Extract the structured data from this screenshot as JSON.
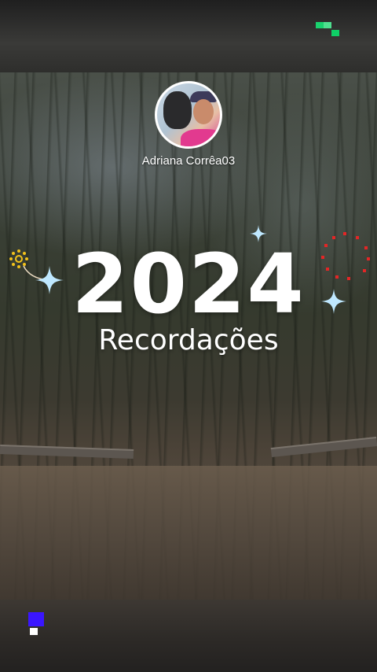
{
  "story": {
    "username": "Adriana Corrêa03",
    "year": "2024",
    "subtitle": "Recordações"
  },
  "icons": {
    "avatar": "profile-photo",
    "top_badge": "green-pixel-logo",
    "bottom_badge": "blue-pixel-logo",
    "decorations": [
      "sparkle-star-icon",
      "sun-flower-icon",
      "dotted-circle-icon"
    ]
  },
  "colors": {
    "text": "#ffffff",
    "accent_green": "#19d26e",
    "accent_blue": "#3a16ff",
    "accent_red": "#e32626",
    "accent_yellow": "#f2c21b",
    "sparkle": "#bfe8ff"
  }
}
